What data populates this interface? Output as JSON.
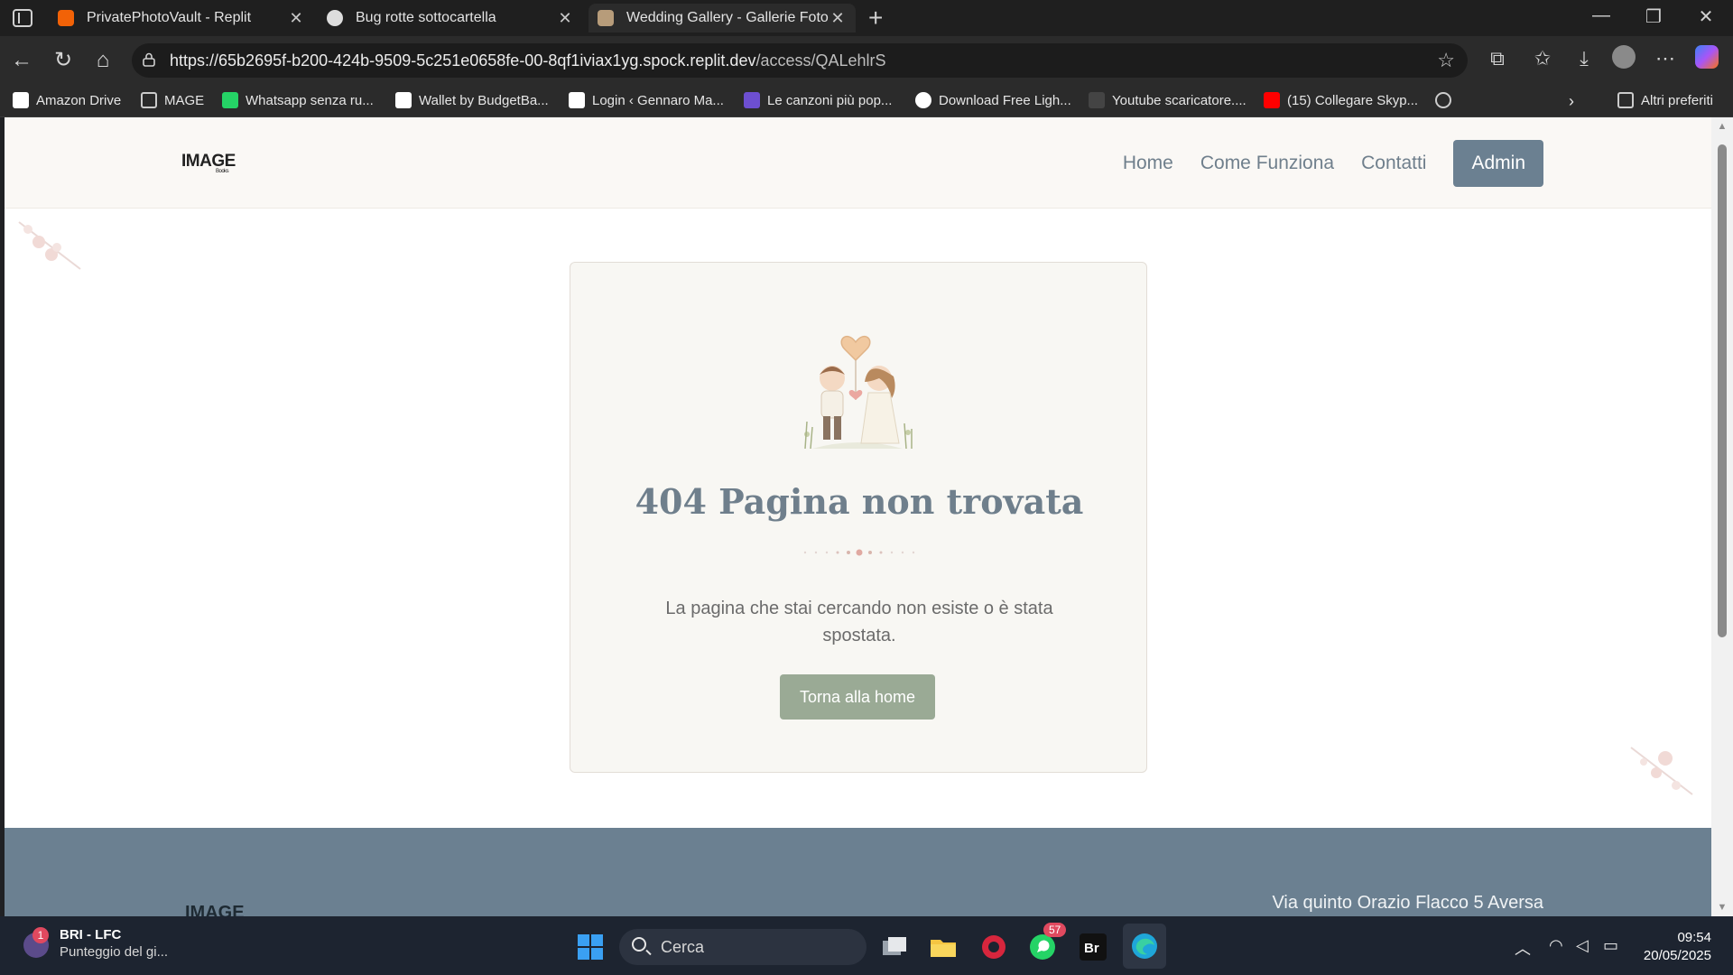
{
  "browser": {
    "tabs": [
      {
        "title": "PrivatePhotoVault - Replit",
        "active": false
      },
      {
        "title": "Bug rotte sottocartella",
        "active": false
      },
      {
        "title": "Wedding Gallery - Gallerie Fotogr",
        "active": true
      }
    ],
    "url_host": "https://65b2695f-b200-424b-9509-5c251e0658fe-00-8qf1iviax1yg.spock.replit.dev",
    "url_path": "/access/QALehlrS",
    "bookmarks": [
      "Amazon Drive",
      "MAGE",
      "Whatsapp senza ru...",
      "Wallet by BudgetBa...",
      "Login ‹ Gennaro Ma...",
      "Le canzoni più pop...",
      "Download Free Ligh...",
      "Youtube scaricatore....",
      "(15) Collegare Skyp..."
    ],
    "other_favorites": "Altri preferiti"
  },
  "site": {
    "logo": "IMAGE",
    "logo_sub": "Books",
    "nav": {
      "home": "Home",
      "how": "Come Funziona",
      "contacts": "Contatti",
      "admin": "Admin"
    },
    "error": {
      "title": "404 Pagina non trovata",
      "message": "La pagina che stai cercando non esiste o è stata spostata.",
      "button": "Torna alla home"
    },
    "footer": {
      "logo": "IMAGE",
      "address": "Via quinto Orazio Flacco 5 Aversa"
    },
    "colors": {
      "accent": "#6b8091",
      "button": "#9aaa95",
      "card_bg": "#f8f7f3"
    }
  },
  "taskbar": {
    "weather_badge": "1",
    "weather_title": "BRI - LFC",
    "weather_sub": "Punteggio del gi...",
    "search_placeholder": "Cerca",
    "whatsapp_badge": "57",
    "time": "09:54",
    "date": "20/05/2025"
  }
}
